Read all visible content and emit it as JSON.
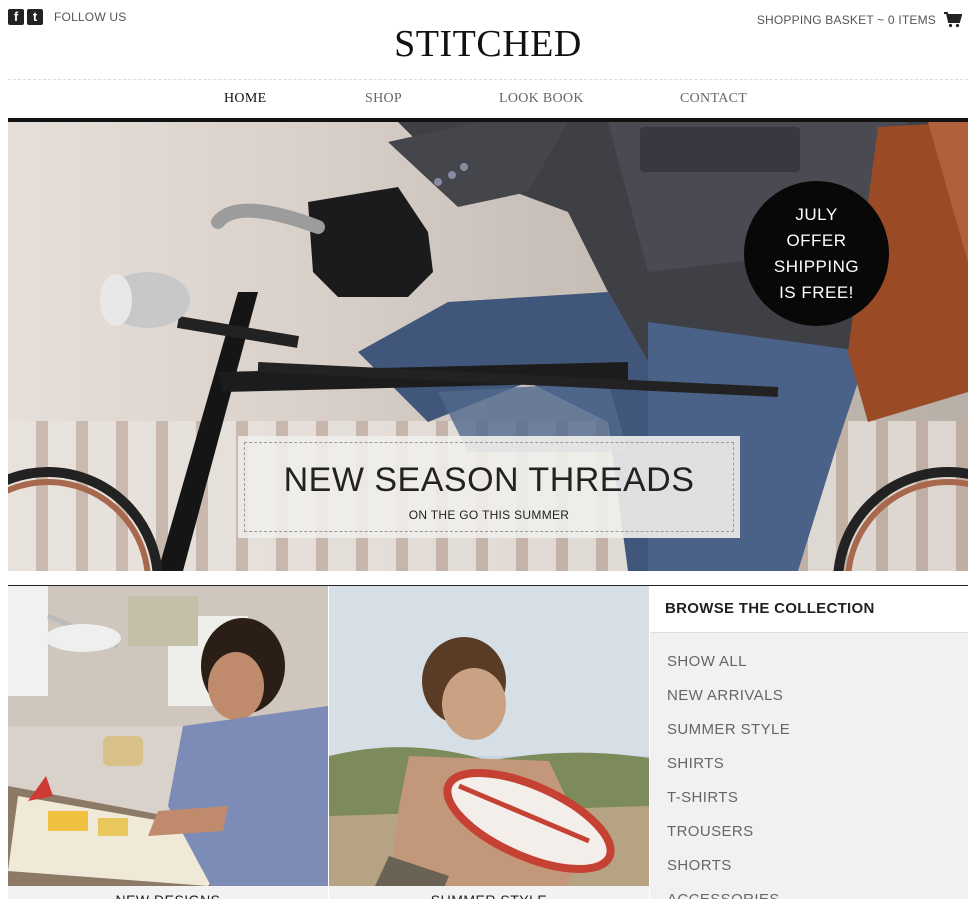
{
  "header": {
    "follow_label": "FOLLOW US",
    "logo": "STITCHED",
    "basket_label": "SHOPPING BASKET ~ 0 ITEMS",
    "social_icons": [
      "facebook-icon",
      "twitter-icon"
    ],
    "cart_icon": "cart-icon"
  },
  "nav": {
    "items": [
      {
        "label": "HOME",
        "active": true
      },
      {
        "label": "SHOP",
        "active": false
      },
      {
        "label": "LOOK BOOK",
        "active": false
      },
      {
        "label": "CONTACT",
        "active": false
      }
    ]
  },
  "hero": {
    "badge_lines": [
      "JULY",
      "OFFER",
      "SHIPPING",
      "IS FREE!"
    ],
    "title": "NEW SEASON THREADS",
    "subtitle": "ON THE GO THIS SUMMER"
  },
  "tiles": [
    {
      "caption": "NEW DESIGNS"
    },
    {
      "caption": "SUMMER STYLE"
    }
  ],
  "sidebar": {
    "title": "BROWSE THE COLLECTION",
    "items": [
      "SHOW ALL",
      "NEW ARRIVALS",
      "SUMMER STYLE",
      "SHIRTS",
      "T-SHIRTS",
      "TROUSERS",
      "SHORTS",
      "ACCESSORIES"
    ]
  },
  "colors": {
    "badge_bg": "#080808",
    "nav_bar": "#111111",
    "sidebar_bg": "#f1f1f1"
  }
}
